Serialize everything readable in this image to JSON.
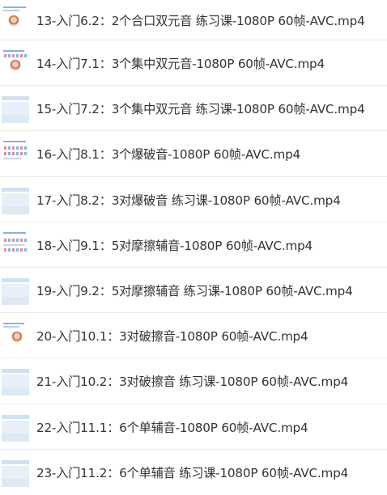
{
  "files": [
    {
      "name": "13-入门6.2：2个合口双元音 练习课-1080P 60帧-AVC.mp4",
      "thumb": "lesson-slide-with-figure"
    },
    {
      "name": "14-入门7.1：3个集中双元音-1080P 60帧-AVC.mp4",
      "thumb": "lesson-slide-with-figure"
    },
    {
      "name": "15-入门7.2：3个集中双元音 练习课-1080P 60帧-AVC.mp4",
      "thumb": "blue-bar-slide"
    },
    {
      "name": "16-入门8.1：3个爆破音-1080P 60帧-AVC.mp4",
      "thumb": "lesson-slide-with-dots"
    },
    {
      "name": "17-入门8.2：3对爆破音 练习课-1080P 60帧-AVC.mp4",
      "thumb": "blue-bar-slide"
    },
    {
      "name": "18-入门9.1：5对摩擦辅音-1080P 60帧-AVC.mp4",
      "thumb": "lesson-slide-with-dots"
    },
    {
      "name": "19-入门9.2：5对摩擦辅音 练习课-1080P 60帧-AVC.mp4",
      "thumb": "blue-bar-slide"
    },
    {
      "name": "20-入门10.1：3对破擦音-1080P 60帧-AVC.mp4",
      "thumb": "lesson-slide-with-figure"
    },
    {
      "name": "21-入门10.2：3对破擦音 练习课-1080P 60帧-AVC.mp4",
      "thumb": "blue-bar-slide"
    },
    {
      "name": "22-入门11.1：6个单辅音-1080P 60帧-AVC.mp4",
      "thumb": "blue-bar-slide"
    },
    {
      "name": "23-入门11.2：6个单辅音 练习课-1080P 60帧-AVC.mp4",
      "thumb": "blue-bar-slide"
    }
  ]
}
